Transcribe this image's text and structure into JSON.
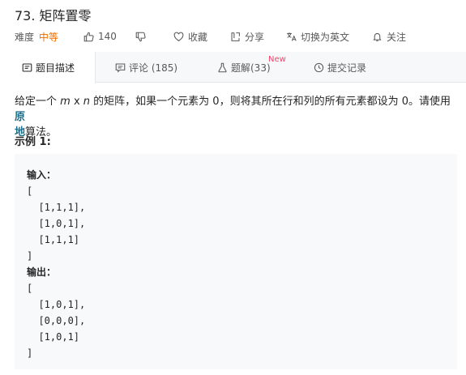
{
  "problem": {
    "title": "73. 矩阵置零",
    "difficulty_label": "难度",
    "difficulty_value": "中等",
    "likes": "140",
    "favorite": "收藏",
    "share": "分享",
    "switch_lang": "切换为英文",
    "follow": "关注"
  },
  "tabs": [
    {
      "label": "题目描述"
    },
    {
      "label": "评论 (185)"
    },
    {
      "label": "题解(33)",
      "badge": "New"
    },
    {
      "label": "提交记录"
    }
  ],
  "description": {
    "p1_before": "给定一个 ",
    "m": "m",
    "x": " x ",
    "n": "n",
    "p1_after": " 的矩阵，如果一个元素为 0，则将其所在行和列的所有元素都设为 0。请使用",
    "strong1": "原",
    "strong2": "地",
    "p2": "算法。"
  },
  "example": {
    "heading": "示例 1:",
    "input_label": "输入：",
    "input_lines": [
      "[",
      "  [1,1,1],",
      "  [1,0,1],",
      "  [1,1,1]",
      "]"
    ],
    "output_label": "输出：",
    "output_lines": [
      "[",
      "  [1,0,1],",
      "  [0,0,0],",
      "  [1,0,1]",
      "]"
    ]
  },
  "colors": {
    "difficulty_medium": "#ef6c00",
    "new_badge": "#f5426c",
    "link": "#1f6f8b",
    "code_bg": "#f7f9fa"
  }
}
